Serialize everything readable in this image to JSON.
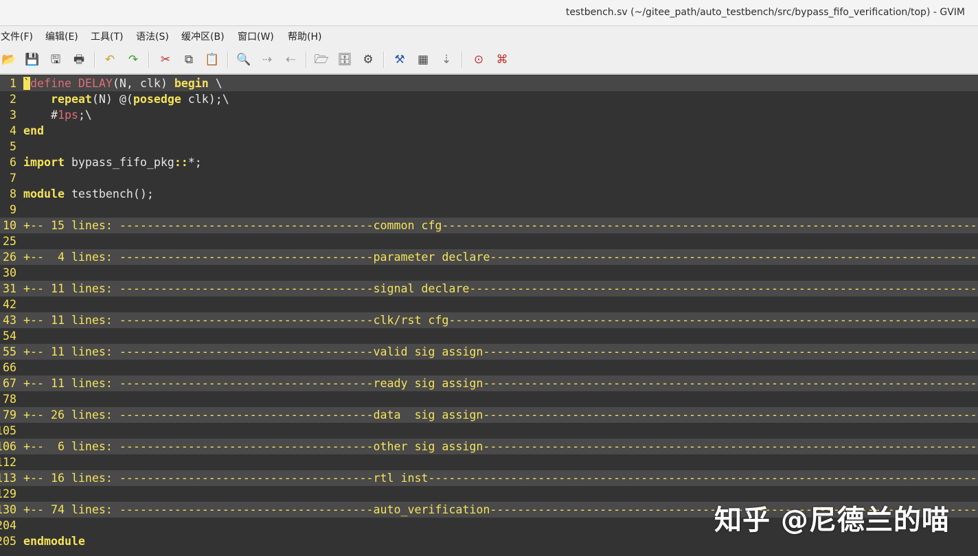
{
  "window": {
    "title": "testbench.sv (~/gitee_path/auto_testbench/src/bypass_fifo_verification/top) - GVIM"
  },
  "menu": [
    "文件(F)",
    "编辑(E)",
    "工具(T)",
    "语法(S)",
    "缓冲区(B)",
    "窗口(W)",
    "帮助(H)"
  ],
  "toolbar": [
    {
      "name": "open-icon",
      "glyph": "📂"
    },
    {
      "name": "save-icon",
      "glyph": "💾"
    },
    {
      "name": "save-all-icon",
      "glyph": "🖫"
    },
    {
      "name": "print-icon",
      "glyph": "🖶"
    },
    {
      "name": "undo-icon",
      "glyph": "↶"
    },
    {
      "name": "redo-icon",
      "glyph": "↷"
    },
    {
      "name": "cut-icon",
      "glyph": "✂"
    },
    {
      "name": "copy-icon",
      "glyph": "⧉"
    },
    {
      "name": "paste-icon",
      "glyph": "📋"
    },
    {
      "name": "find-replace-icon",
      "glyph": "🔍"
    },
    {
      "name": "find-next-icon",
      "glyph": "⇢"
    },
    {
      "name": "find-prev-icon",
      "glyph": "⇠"
    },
    {
      "name": "load-session-icon",
      "glyph": "🗁"
    },
    {
      "name": "save-session-icon",
      "glyph": "🗄"
    },
    {
      "name": "run-script-icon",
      "glyph": "⚙"
    },
    {
      "name": "make-icon",
      "glyph": "⚒"
    },
    {
      "name": "shell-icon",
      "glyph": "▦"
    },
    {
      "name": "jump-tag-icon",
      "glyph": "⇣"
    },
    {
      "name": "help-icon",
      "glyph": "⊙"
    },
    {
      "name": "find-help-icon",
      "glyph": "⌘"
    }
  ],
  "editor": {
    "lines": [
      {
        "n": "1",
        "segs": [
          [
            "cursor",
            "`"
          ],
          [
            "pre",
            "define DELAY"
          ],
          [
            "sym",
            "(N, clk) "
          ],
          [
            "kw",
            "begin"
          ],
          [
            "sym",
            " \\"
          ]
        ]
      },
      {
        "n": "2",
        "segs": [
          [
            "sym",
            "    "
          ],
          [
            "kw",
            "repeat"
          ],
          [
            "sym",
            "(N) @("
          ],
          [
            "kw",
            "posedge"
          ],
          [
            "sym",
            " clk);\\"
          ]
        ]
      },
      {
        "n": "3",
        "segs": [
          [
            "sym",
            "    #"
          ],
          [
            "num",
            "1ps"
          ],
          [
            "sym",
            ";\\"
          ]
        ]
      },
      {
        "n": "4",
        "segs": [
          [
            "kw",
            "end"
          ]
        ]
      },
      {
        "n": "5",
        "segs": []
      },
      {
        "n": "6",
        "segs": [
          [
            "kw",
            "import"
          ],
          [
            "sym",
            " bypass_fifo_pkg"
          ],
          [
            "kw",
            "::"
          ],
          [
            "sym",
            "*;"
          ]
        ]
      },
      {
        "n": "7",
        "segs": []
      },
      {
        "n": "8",
        "segs": [
          [
            "kw",
            "module"
          ],
          [
            "sym",
            " testbench();"
          ]
        ]
      },
      {
        "n": "9",
        "segs": []
      },
      {
        "n": "10",
        "fold": "+-- 15 lines: -------------------------------------common cfg---------------------------------------------------------------------------------"
      },
      {
        "n": "25",
        "segs": []
      },
      {
        "n": "26",
        "fold": "+--  4 lines: -------------------------------------parameter declare--------------------------------------------------------------------------"
      },
      {
        "n": "30",
        "segs": []
      },
      {
        "n": "31",
        "fold": "+-- 11 lines: -------------------------------------signal declare-----------------------------------------------------------------------------"
      },
      {
        "n": "42",
        "segs": []
      },
      {
        "n": "43",
        "fold": "+-- 11 lines: -------------------------------------clk/rst cfg--------------------------------------------------------------------------------"
      },
      {
        "n": "54",
        "segs": []
      },
      {
        "n": "55",
        "fold": "+-- 11 lines: -------------------------------------valid sig assign---------------------------------------------------------------------------"
      },
      {
        "n": "66",
        "segs": []
      },
      {
        "n": "67",
        "fold": "+-- 11 lines: -------------------------------------ready sig assign---------------------------------------------------------------------------"
      },
      {
        "n": "78",
        "segs": []
      },
      {
        "n": "79",
        "fold": "+-- 26 lines: -------------------------------------data  sig assign---------------------------------------------------------------------------"
      },
      {
        "n": "105",
        "segs": []
      },
      {
        "n": "106",
        "fold": "+--  6 lines: -------------------------------------other sig assign---------------------------------------------------------------------------"
      },
      {
        "n": "112",
        "segs": []
      },
      {
        "n": "113",
        "fold": "+-- 16 lines: -------------------------------------rtl inst-----------------------------------------------------------------------------------"
      },
      {
        "n": "129",
        "segs": []
      },
      {
        "n": "130",
        "fold": "+-- 74 lines: -------------------------------------auto_verification--------------------------------------------------------------------------"
      },
      {
        "n": "204",
        "segs": []
      },
      {
        "n": "205",
        "segs": [
          [
            "kw",
            "endmodule"
          ]
        ]
      }
    ]
  },
  "watermark": "知乎 @尼德兰的喵"
}
